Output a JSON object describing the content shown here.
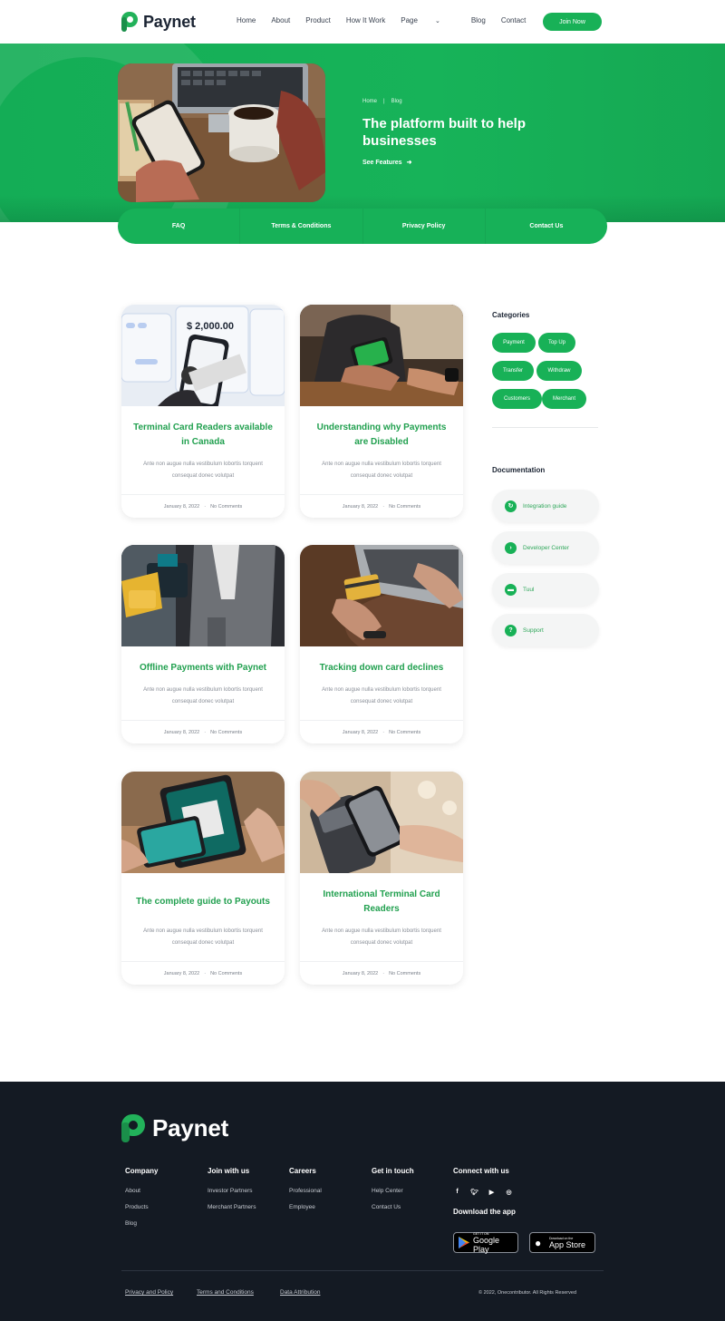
{
  "brand": {
    "name": "Paynet",
    "accent": "#18b157",
    "dark": "#141a23"
  },
  "nav": {
    "items": [
      "Home",
      "About",
      "Product",
      "How It Work",
      "Page",
      "Blog",
      "Contact"
    ],
    "join_label": "Join Now"
  },
  "hero": {
    "breadcrumb": [
      "Home",
      "Blog"
    ],
    "title": "The platform built to help businesses",
    "cta": "See Features"
  },
  "tabs": [
    "FAQ",
    "Terms & Conditions",
    "Privacy Policy",
    "Contact Us"
  ],
  "posts": [
    {
      "title": "Terminal Card Readers available in Canada",
      "excerpt": "Ante non augue nulla vestibulum lobortis torquent consequat donec volutpat",
      "date": "January 8, 2022",
      "comments": "No Comments",
      "image_text": "$ 2,000.00"
    },
    {
      "title": "Understanding why Payments are Disabled",
      "excerpt": "Ante non augue nulla vestibulum lobortis torquent consequat donec volutpat",
      "date": "January 8, 2022",
      "comments": "No Comments"
    },
    {
      "title": "Offline Payments with Paynet",
      "excerpt": "Ante non augue nulla vestibulum lobortis torquent consequat donec volutpat",
      "date": "January 8, 2022",
      "comments": "No Comments"
    },
    {
      "title": "Tracking down card declines",
      "excerpt": "Ante non augue nulla vestibulum lobortis torquent consequat donec volutpat",
      "date": "January 8, 2022",
      "comments": "No Comments"
    },
    {
      "title": "The complete guide to Payouts",
      "excerpt": "Ante non augue nulla vestibulum lobortis torquent consequat donec volutpat",
      "date": "January 8, 2022",
      "comments": "No Comments"
    },
    {
      "title": "International Terminal Card Readers",
      "excerpt": "Ante non augue nulla vestibulum lobortis torquent consequat donec volutpat",
      "date": "January 8, 2022",
      "comments": "No Comments"
    }
  ],
  "sidebar": {
    "categories_title": "Categories",
    "categories": [
      "Payment",
      "Top Up",
      "Transfer",
      "Withdraw",
      "Customers",
      "Merchant"
    ],
    "documentation_title": "Documentation",
    "docs": [
      {
        "label": "Integration guide",
        "icon": "refresh-icon"
      },
      {
        "label": "Developer Center",
        "icon": "terminal-icon"
      },
      {
        "label": "Tuul",
        "icon": "toolbox-icon"
      },
      {
        "label": "Support",
        "icon": "help-icon"
      }
    ]
  },
  "footer": {
    "columns": [
      {
        "title": "Company",
        "links": [
          "About",
          "Products",
          "Blog"
        ]
      },
      {
        "title": "Join with us",
        "links": [
          "Investor Partners",
          "Merchant Partners"
        ]
      },
      {
        "title": "Careers",
        "links": [
          "Professional",
          "Employee"
        ]
      },
      {
        "title": "Get in touch",
        "links": [
          "Help Center",
          "Contact Us"
        ]
      }
    ],
    "connect_title": "Connect with us",
    "social": [
      "facebook-icon",
      "twitter-icon",
      "youtube-icon",
      "instagram-icon"
    ],
    "download_title": "Download the app",
    "google_small": "GET IT ON",
    "google_big": "Google Play",
    "apple_small": "Download on the",
    "apple_big": "App Store",
    "bottom_links": [
      "Privacy and Policy",
      "Terms and Conditions",
      "Data Attribution"
    ],
    "copyright": "© 2022, Onecontributor. All Rights Reserved"
  }
}
